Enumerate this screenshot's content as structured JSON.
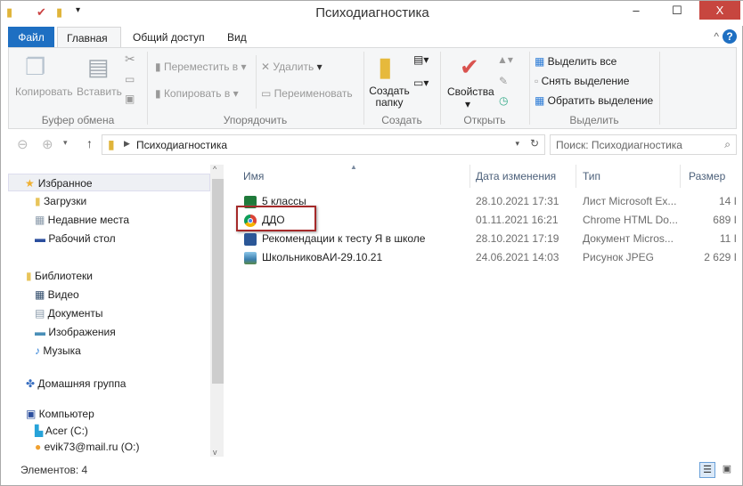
{
  "window": {
    "title": "Психодиагностика",
    "minimize": "‒",
    "maximize": "☐",
    "close": "X"
  },
  "ribbon_tabs": [
    {
      "label": "Файл"
    },
    {
      "label": "Главная"
    },
    {
      "label": "Общий доступ"
    },
    {
      "label": "Вид"
    }
  ],
  "ribbon": {
    "clipboard": {
      "copy": "Копировать",
      "paste": "Вставить",
      "group": "Буфер обмена"
    },
    "organize": {
      "move_to": "Переместить в",
      "copy_to": "Копировать в",
      "delete": "Удалить",
      "rename": "Переименовать",
      "group": "Упорядочить"
    },
    "create": {
      "new_folder_1": "Создать",
      "new_folder_2": "папку",
      "group": "Создать"
    },
    "open": {
      "properties": "Свойства",
      "group": "Открыть"
    },
    "select": {
      "select_all": "Выделить все",
      "select_none": "Снять выделение",
      "invert": "Обратить выделение",
      "group": "Выделить"
    }
  },
  "address": {
    "path": "Психодиагностика",
    "search_placeholder": "Поиск: Психодиагностика"
  },
  "nav": [
    {
      "label": "Избранное",
      "icon": "star-icon",
      "color": "#f0b030"
    },
    {
      "label": "Загрузки",
      "icon": "downloads-icon",
      "color": "#e8c45a"
    },
    {
      "label": "Недавние места",
      "icon": "recent-places-icon",
      "color": "#8a9aaa"
    },
    {
      "label": "Рабочий стол",
      "icon": "desktop-icon",
      "color": "#2c4f9e"
    },
    {
      "label": "Библиотеки",
      "icon": "libraries-icon",
      "color": "#e8c45a"
    },
    {
      "label": "Видео",
      "icon": "video-icon",
      "color": "#2f4b6a"
    },
    {
      "label": "Документы",
      "icon": "documents-icon",
      "color": "#cfd6de"
    },
    {
      "label": "Изображения",
      "icon": "pictures-icon",
      "color": "#4a8fb8"
    },
    {
      "label": "Музыка",
      "icon": "music-icon",
      "color": "#2f7fd6"
    },
    {
      "label": "Домашняя группа",
      "icon": "homegroup-icon",
      "color": "#3a6fc0"
    },
    {
      "label": "Компьютер",
      "icon": "computer-icon",
      "color": "#2c4f9e"
    },
    {
      "label": "Acer (C:)",
      "icon": "drive-icon",
      "color": "#27a3d9"
    },
    {
      "label": "evik73@mail.ru (O:)",
      "icon": "network-drive-icon",
      "color": "#f0a030"
    }
  ],
  "columns": {
    "name": "Имя",
    "date": "Дата изменения",
    "type": "Тип",
    "size": "Размер"
  },
  "files": [
    {
      "name": "5 классы",
      "date": "28.10.2021 17:31",
      "type": "Лист Microsoft Ex...",
      "size": "14 I",
      "icon": "excel-icon",
      "color": "#1f7a3a"
    },
    {
      "name": "ДДО",
      "date": "01.11.2021 16:21",
      "type": "Chrome HTML Do...",
      "size": "689 I",
      "icon": "chrome-icon",
      "color": "#db4437"
    },
    {
      "name": "Рекомендации к тесту Я в школе",
      "date": "28.10.2021 17:19",
      "type": "Документ Micros...",
      "size": "11 I",
      "icon": "word-icon",
      "color": "#2b5797"
    },
    {
      "name": "ШкольниковАИ-29.10.21",
      "date": "24.06.2021 14:03",
      "type": "Рисунок JPEG",
      "size": "2 629 I",
      "icon": "image-icon",
      "color": "#3b7fb0"
    }
  ],
  "status": {
    "count": "Элементов: 4"
  },
  "highlight_color": "#a52a2a"
}
